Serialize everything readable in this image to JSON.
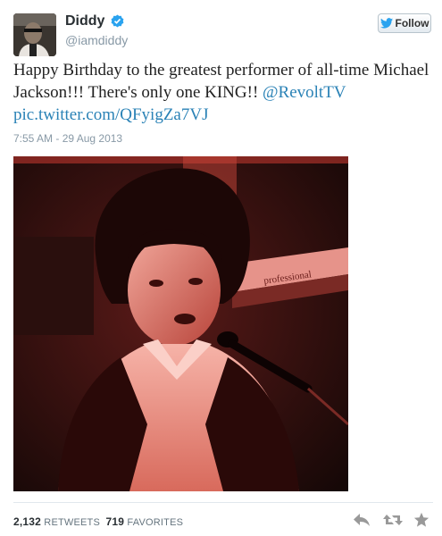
{
  "user": {
    "display_name": "Diddy",
    "handle": "@iamdiddy",
    "verified": true,
    "avatar_icon": "avatar-photo"
  },
  "follow_button": {
    "label": "Follow",
    "icon": "twitter-bird-icon"
  },
  "tweet": {
    "text_main": "Happy Birthday to the greatest performer of all-time Michael Jackson!!! There's only one KING!! ",
    "mention": "@RevoltTV",
    "link": "pic.twitter.com/QFyigZa7VJ",
    "timestamp": "7:55 AM - 29 Aug 2013"
  },
  "photo": {
    "sign_text": "professional"
  },
  "stats": {
    "retweets_count": "2,132",
    "retweets_label": "RETWEETS",
    "favorites_count": "719",
    "favorites_label": "FAVORITES"
  },
  "actions": [
    "reply-icon",
    "retweet-icon",
    "favorite-icon"
  ],
  "colors": {
    "link": "#2a82b6",
    "verified": "#2aa3ef",
    "photo_tint": "#d8524a",
    "muted": "#8899a6"
  }
}
